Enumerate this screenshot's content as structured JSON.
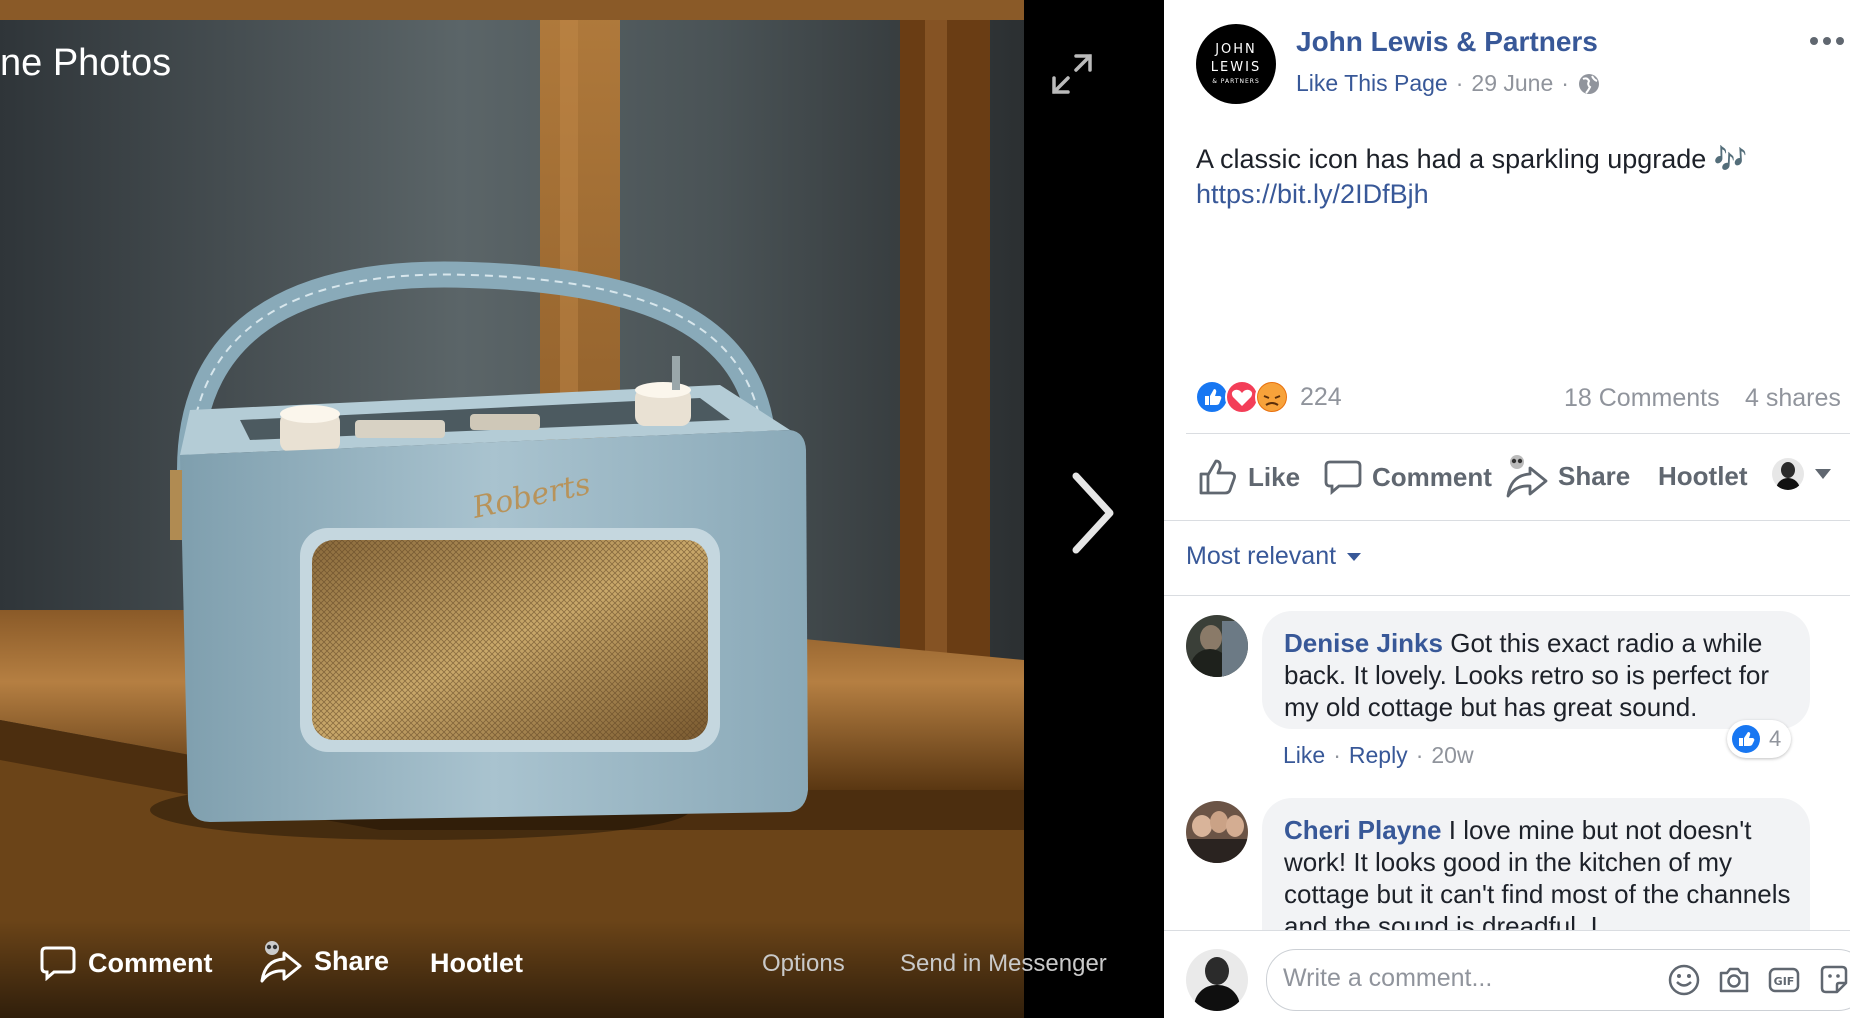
{
  "viewer": {
    "album_title": "ne Photos",
    "bottom_bar": {
      "comment_label": "Comment",
      "share_label": "Share",
      "hootlet_label": "Hootlet",
      "options_label": "Options",
      "send_label": "Send in Messenger"
    },
    "photo": {
      "brand_script": "Roberts"
    }
  },
  "post": {
    "page_logo_lines": [
      "JOHN",
      "LEWIS",
      "& PARTNERS"
    ],
    "page_name": "John Lewis & Partners",
    "like_page": "Like This Page",
    "date": "29 June",
    "separator": "·",
    "text": "A classic icon has had a sparkling upgrade 🎶",
    "link": "https://bit.ly/2IDfBjh",
    "reactions_count": "224",
    "comments_count": "18 Comments",
    "shares_count": "4 shares",
    "actions": {
      "like": "Like",
      "comment": "Comment",
      "share": "Share",
      "hootlet": "Hootlet"
    },
    "sort_label": "Most relevant"
  },
  "comments": [
    {
      "author": "Denise Jinks",
      "text": "Got this exact radio a while back. It lovely. Looks retro so is perfect for my old cottage but has great sound.",
      "like": "Like",
      "reply": "Reply",
      "time": "20w",
      "reaction_count": "4"
    },
    {
      "author": "Cheri Playne",
      "text": "I love mine but not doesn't work! It looks good in the kitchen of my cottage but it can't find most of the channels and the sound is dreadful. I"
    }
  ],
  "composer": {
    "placeholder": "Write a comment..."
  },
  "colors": {
    "accent": "#385898",
    "like_blue": "#1877f2",
    "love_red": "#f33e58",
    "angry_orange": "#e9710f"
  }
}
